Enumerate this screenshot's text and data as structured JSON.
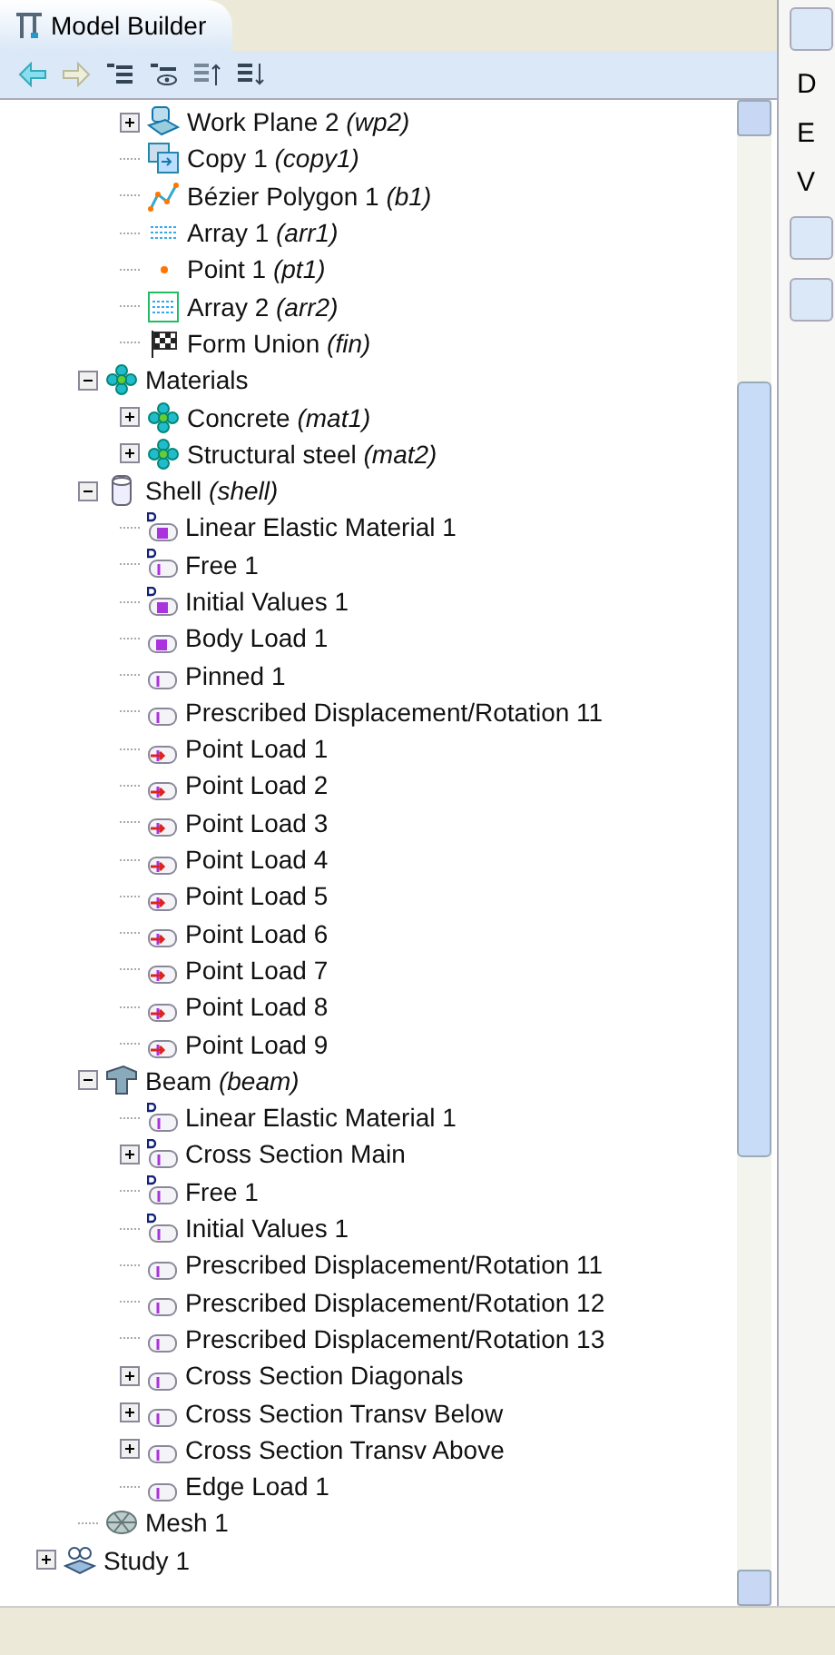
{
  "panel": {
    "title": "Model Builder"
  },
  "tree": [
    {
      "children": [
        {
          "children": [
            {
              "label": "Work Plane 2",
              "tag": "(wp2)",
              "kind": "workplane",
              "expanded": false
            },
            {
              "label": "Copy 1",
              "tag": "(copy1)",
              "kind": "copy"
            },
            {
              "label": "Bézier Polygon 1",
              "tag": "(b1)",
              "kind": "bezier"
            },
            {
              "label": "Array 1",
              "tag": "(arr1)",
              "kind": "array"
            },
            {
              "label": "Point 1",
              "tag": "(pt1)",
              "kind": "point"
            },
            {
              "label": "Array 2",
              "tag": "(arr2)",
              "kind": "array-boxed"
            },
            {
              "label": "Form Union",
              "tag": "(fin)",
              "kind": "union"
            }
          ]
        },
        {
          "label": "Materials",
          "kind": "materials",
          "expanded": true,
          "children": [
            {
              "label": "Concrete",
              "tag": "(mat1)",
              "kind": "material",
              "expanded": false
            },
            {
              "label": "Structural steel",
              "tag": "(mat2)",
              "kind": "material",
              "expanded": false
            }
          ]
        },
        {
          "label": "Shell",
          "tag": "(shell)",
          "kind": "shell",
          "expanded": true,
          "children": [
            {
              "label": "Linear Elastic Material 1",
              "kind": "default-domain"
            },
            {
              "label": "Free 1",
              "kind": "default-feature"
            },
            {
              "label": "Initial Values 1",
              "kind": "default-domain"
            },
            {
              "label": "Body Load 1",
              "kind": "domain"
            },
            {
              "label": "Pinned 1",
              "kind": "feature"
            },
            {
              "label": "Prescribed Displacement/Rotation 11",
              "kind": "feature"
            },
            {
              "label": "Point Load 1",
              "kind": "point-load"
            },
            {
              "label": "Point Load 2",
              "kind": "point-load"
            },
            {
              "label": "Point Load 3",
              "kind": "point-load"
            },
            {
              "label": "Point Load 4",
              "kind": "point-load"
            },
            {
              "label": "Point Load 5",
              "kind": "point-load"
            },
            {
              "label": "Point Load 6",
              "kind": "point-load"
            },
            {
              "label": "Point Load 7",
              "kind": "point-load"
            },
            {
              "label": "Point Load 8",
              "kind": "point-load"
            },
            {
              "label": "Point Load 9",
              "kind": "point-load"
            }
          ]
        },
        {
          "label": "Beam",
          "tag": "(beam)",
          "kind": "beam",
          "expanded": true,
          "children": [
            {
              "label": "Linear Elastic Material 1",
              "kind": "default-feature"
            },
            {
              "label": "Cross Section Main",
              "kind": "default-feature",
              "expanded": false
            },
            {
              "label": "Free 1",
              "kind": "default-feature"
            },
            {
              "label": "Initial Values 1",
              "kind": "default-feature"
            },
            {
              "label": "Prescribed Displacement/Rotation 11",
              "kind": "feature"
            },
            {
              "label": "Prescribed Displacement/Rotation 12",
              "kind": "feature"
            },
            {
              "label": "Prescribed Displacement/Rotation 13",
              "kind": "feature"
            },
            {
              "label": "Cross Section Diagonals",
              "kind": "feature",
              "expanded": false
            },
            {
              "label": "Cross Section Transv Below",
              "kind": "feature",
              "expanded": false
            },
            {
              "label": "Cross Section Transv Above",
              "kind": "feature",
              "expanded": false
            },
            {
              "label": "Edge Load 1",
              "kind": "feature"
            }
          ]
        },
        {
          "label": "Mesh 1",
          "kind": "mesh"
        }
      ]
    },
    {
      "label": "Study 1",
      "kind": "study",
      "expanded": false
    }
  ],
  "side_panel": {
    "texts": [
      "D",
      "E",
      "V"
    ]
  }
}
